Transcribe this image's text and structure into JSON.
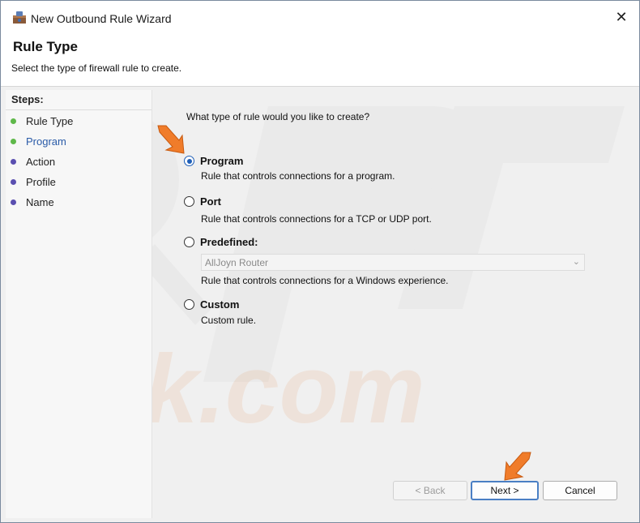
{
  "window": {
    "title": "New Outbound Rule Wizard",
    "close_glyph": "✕"
  },
  "header": {
    "title": "Rule Type",
    "subtitle": "Select the type of firewall rule to create."
  },
  "steps": {
    "heading": "Steps:",
    "items": [
      {
        "label": "Rule Type",
        "state": "done",
        "color": "#5fb84a"
      },
      {
        "label": "Program",
        "state": "current",
        "color": "#5fb84a"
      },
      {
        "label": "Action",
        "state": "pending",
        "color": "#5a4fb0"
      },
      {
        "label": "Profile",
        "state": "pending",
        "color": "#5a4fb0"
      },
      {
        "label": "Name",
        "state": "pending",
        "color": "#5a4fb0"
      }
    ]
  },
  "content": {
    "question": "What type of rule would you like to create?",
    "options": [
      {
        "label": "Program",
        "description": "Rule that controls connections for a program.",
        "checked": true
      },
      {
        "label": "Port",
        "description": "Rule that controls connections for a TCP or UDP port.",
        "checked": false
      },
      {
        "label": "Predefined:",
        "description": "Rule that controls connections for a Windows experience.",
        "checked": false
      },
      {
        "label": "Custom",
        "description": "Custom rule.",
        "checked": false
      }
    ],
    "predefined_select": {
      "value": "AllJoyn Router",
      "enabled": false
    }
  },
  "buttons": {
    "back": "< Back",
    "next": "Next >",
    "cancel": "Cancel"
  },
  "colors": {
    "accent": "#1f5fb8",
    "annotation_arrow": "#f07c2a"
  },
  "icons": {
    "title": "firewall-wizard-icon",
    "close": "close-icon"
  }
}
